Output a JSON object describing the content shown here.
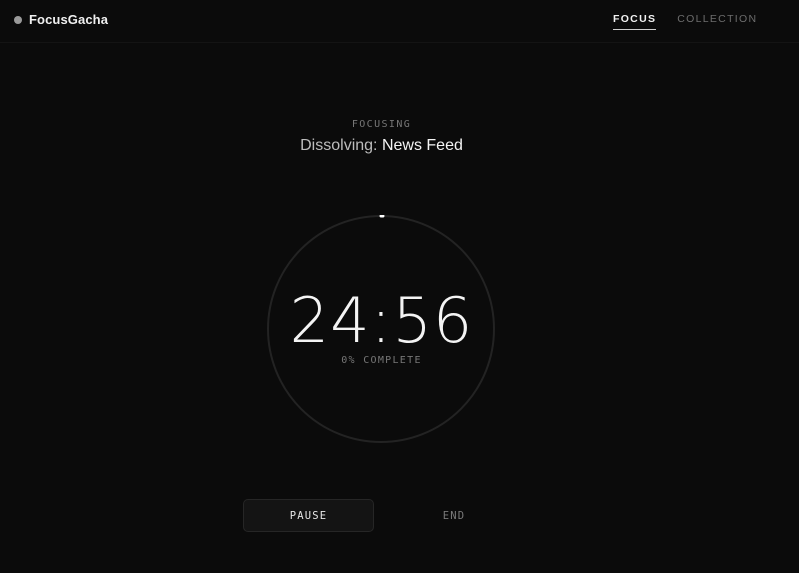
{
  "app": {
    "name": "FocusGacha"
  },
  "nav": {
    "tabs": [
      {
        "label": "FOCUS",
        "active": true
      },
      {
        "label": "COLLECTION",
        "active": false
      }
    ]
  },
  "session": {
    "status": "FOCUSING",
    "dissolving_prefix": "Dissolving:",
    "dissolving_target": "News Feed",
    "time_remaining": "24:56",
    "progress_text": "0% COMPLETE",
    "progress_fraction": 0.0
  },
  "controls": {
    "pause_label": "PAUSE",
    "end_label": "END"
  },
  "colors": {
    "background": "#0b0b0b",
    "ring_track": "#232323",
    "ring_progress": "#ffffff",
    "text_primary": "#f4f4f4",
    "text_muted": "#777777"
  }
}
